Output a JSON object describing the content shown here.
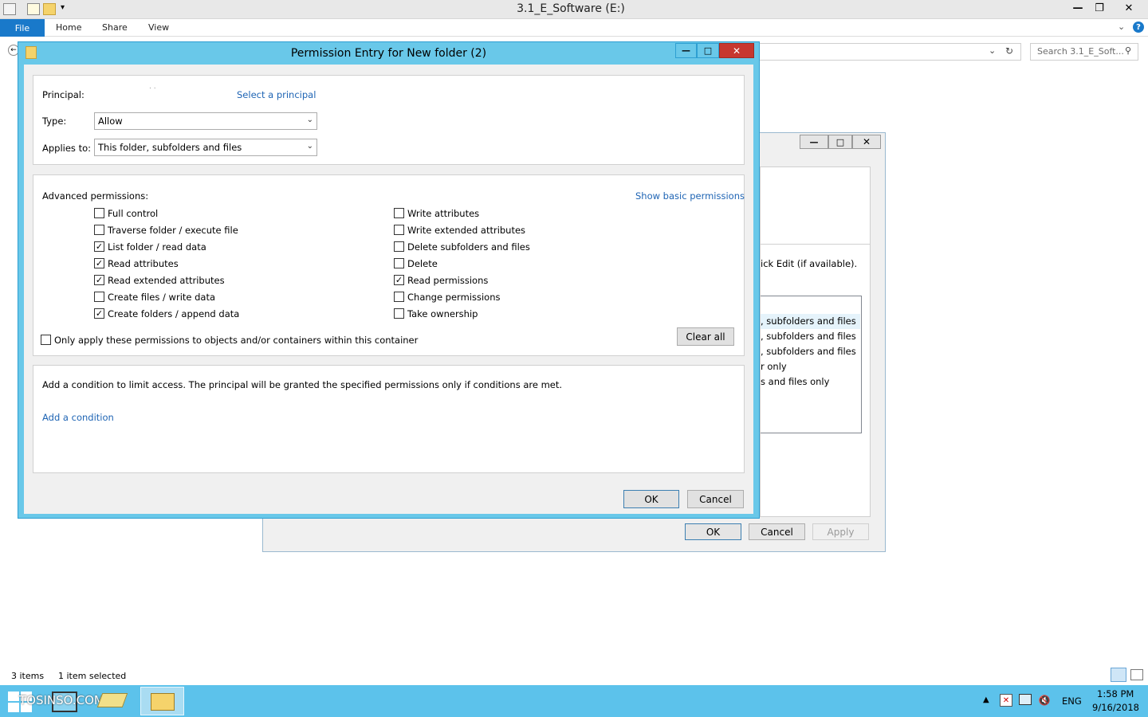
{
  "explorer": {
    "title": "3.1_E_Software (E:)",
    "tabs": {
      "file": "File",
      "home": "Home",
      "share": "Share",
      "view": "View"
    },
    "search_placeholder": "Search 3.1_E_Soft...",
    "status": {
      "items": "3 items",
      "selected": "1 item selected"
    }
  },
  "bg_dialog": {
    "text": "ick Edit (if available).",
    "list": [
      ", subfolders and files",
      ", subfolders and files",
      ", subfolders and files",
      "r only",
      "s and files only"
    ],
    "ok": "OK",
    "cancel": "Cancel",
    "apply": "Apply"
  },
  "dialog": {
    "title": "Permission Entry for New folder (2)",
    "principal_label": "Principal:",
    "principal_value": ". .",
    "select_principal": "Select a principal",
    "type_label": "Type:",
    "type_value": "Allow",
    "applies_label": "Applies to:",
    "applies_value": "This folder, subfolders and files",
    "advanced_label": "Advanced permissions:",
    "show_basic": "Show basic permissions",
    "permissions_left": [
      {
        "label": "Full control",
        "checked": false
      },
      {
        "label": "Traverse folder / execute file",
        "checked": false
      },
      {
        "label": "List folder / read data",
        "checked": true
      },
      {
        "label": "Read attributes",
        "checked": true
      },
      {
        "label": "Read extended attributes",
        "checked": true
      },
      {
        "label": "Create files / write data",
        "checked": false
      },
      {
        "label": "Create folders / append data",
        "checked": true
      }
    ],
    "permissions_right": [
      {
        "label": "Write attributes",
        "checked": false
      },
      {
        "label": "Write extended attributes",
        "checked": false
      },
      {
        "label": "Delete subfolders and files",
        "checked": false
      },
      {
        "label": "Delete",
        "checked": false
      },
      {
        "label": "Read permissions",
        "checked": true
      },
      {
        "label": "Change permissions",
        "checked": false
      },
      {
        "label": "Take ownership",
        "checked": false
      }
    ],
    "only_apply": "Only apply these permissions to objects and/or containers within this container",
    "clear_all": "Clear all",
    "condition_text": "Add a condition to limit access. The principal will be granted the specified permissions only if conditions are met.",
    "add_condition": "Add a condition",
    "ok": "OK",
    "cancel": "Cancel"
  },
  "taskbar": {
    "watermark": "TOSINSO.COM",
    "lang": "ENG",
    "time": "1:58 PM",
    "date": "9/16/2018"
  }
}
